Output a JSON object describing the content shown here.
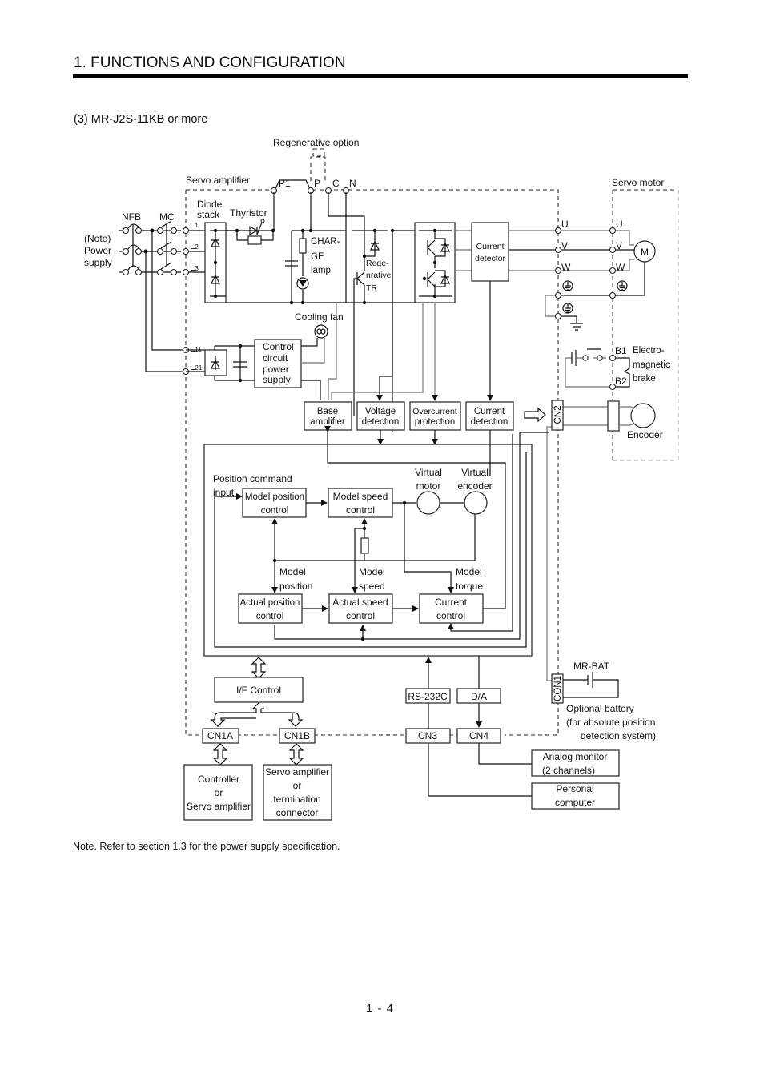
{
  "header": {
    "section_title": "1. FUNCTIONS AND CONFIGURATION",
    "subsection_title": "(3) MR-J2S-11KB or more"
  },
  "diagram": {
    "top_labels": {
      "regenerative_option": "Regenerative option",
      "servo_amplifier": "Servo amplifier",
      "servo_motor": "Servo motor",
      "P1": "P1",
      "P": "P",
      "C": "C",
      "N": "N"
    },
    "power_input": {
      "nfb": "NFB",
      "mc": "MC",
      "note_line1": "(Note)",
      "note_line2": "Power",
      "note_line3": "supply",
      "terminals": [
        "L",
        "L",
        "L",
        "L",
        "L"
      ],
      "terminal_subs": [
        "1",
        "2",
        "3",
        "11",
        "21"
      ]
    },
    "main_circuit": {
      "diode_stack_1": "Diode",
      "diode_stack_2": "stack",
      "thyristor": "Thyristor",
      "charge_1": "CHAR-",
      "charge_2": "GE",
      "charge_3": "lamp",
      "regen_1": "Rege-",
      "regen_2": "nrative",
      "regen_3": "TR",
      "current_detector_1": "Current",
      "current_detector_2": "detector",
      "cooling_fan": "Cooling fan"
    },
    "control_power": {
      "line1": "Control",
      "line2": "circuit",
      "line3": "power",
      "line4": "supply"
    },
    "detection_blocks": [
      {
        "line1": "Base",
        "line2": "amplifier"
      },
      {
        "line1": "Voltage",
        "line2": "detection"
      },
      {
        "line1": "Overcurrent",
        "line2": "protection"
      },
      {
        "line1": "Current",
        "line2": "detection"
      }
    ],
    "motor": {
      "uvw_amp": [
        "U",
        "V",
        "W"
      ],
      "uvw_motor": [
        "U",
        "V",
        "W"
      ],
      "motor_symbol": "M",
      "b1": "B1",
      "b2": "B2",
      "brake_1": "Electro-",
      "brake_2": "magnetic",
      "brake_3": "brake",
      "encoder": "Encoder",
      "cn2": "CN2"
    },
    "control_loop": {
      "position_cmd_1": "Position command",
      "position_cmd_2": "input",
      "model_position_1": "Model position",
      "model_position_2": "control",
      "model_speed_1": "Model speed",
      "model_speed_2": "control",
      "virtual_motor_1": "Virtual",
      "virtual_motor_2": "motor",
      "virtual_encoder_1": "Virtual",
      "virtual_encoder_2": "encoder",
      "label_model_position_1": "Model",
      "label_model_position_2": "position",
      "label_model_speed_1": "Model",
      "label_model_speed_2": "speed",
      "label_model_torque_1": "Model",
      "label_model_torque_2": "torque",
      "actual_position_1": "Actual position",
      "actual_position_2": "control",
      "actual_speed_1": "Actual speed",
      "actual_speed_2": "control",
      "current_control_1": "Current",
      "current_control_2": "control"
    },
    "interfaces": {
      "if_control": "I/F Control",
      "rs232c": "RS-232C",
      "da": "D/A",
      "cn1a": "CN1A",
      "cn1b": "CN1B",
      "cn3": "CN3",
      "cn4": "CN4",
      "con1": "CON1",
      "mr_bat": "MR-BAT",
      "battery_1": "Optional battery",
      "battery_2": "(for absolute position",
      "battery_3": "detection system)"
    },
    "external": {
      "controller_1": "Controller",
      "controller_2": "or",
      "controller_3": "Servo amplifier",
      "servo_amp_1": "Servo amplifier",
      "servo_amp_2": "or",
      "servo_amp_3": "termination",
      "servo_amp_4": "connector",
      "analog_monitor_1": "Analog monitor",
      "analog_monitor_2": "(2 channels)",
      "pc_1": "Personal",
      "pc_2": "computer"
    }
  },
  "footer": {
    "note": "Note. Refer to section 1.3 for the power supply specification.",
    "page_number": "1 -  4"
  }
}
